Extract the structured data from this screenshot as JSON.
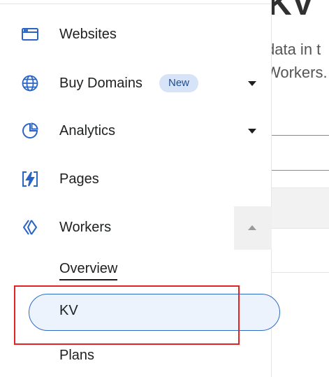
{
  "main": {
    "heading": "KV",
    "desc_line1": "data in t",
    "desc_line2": "Workers."
  },
  "sidebar": {
    "items": [
      {
        "label": "Websites",
        "icon": "browser-window-icon"
      },
      {
        "label": "Buy Domains",
        "icon": "globe-www-icon",
        "badge": "New"
      },
      {
        "label": "Analytics",
        "icon": "pie-chart-icon"
      },
      {
        "label": "Pages",
        "icon": "lightning-page-icon"
      },
      {
        "label": "Workers",
        "icon": "workers-chevrons-icon"
      }
    ],
    "workers_sub": {
      "overview": "Overview",
      "kv": "KV",
      "plans": "Plans"
    }
  },
  "colors": {
    "icon_blue": "#2a64c6",
    "badge_bg": "#d7e4f7",
    "active_border": "#2f6cc6",
    "highlight_red": "#e02424"
  }
}
